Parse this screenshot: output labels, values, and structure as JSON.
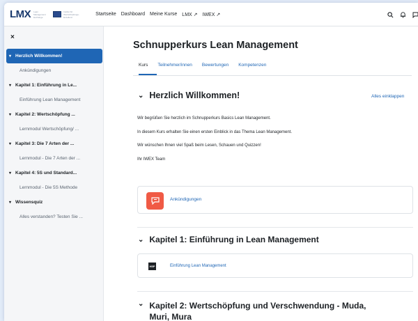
{
  "brand": {
    "logo": "LMX",
    "logo_sub": "Lean Management Exchange",
    "partner_text": "Institut für Wertschöpfungs-Exzellenz"
  },
  "topnav": {
    "items": [
      "Startseite",
      "Dashboard",
      "Meine Kurse",
      "LMX ↗",
      "IWEX ↗"
    ]
  },
  "icons": {
    "search": "search-icon",
    "bell": "bell-icon",
    "chat": "chat-icon",
    "close": "close-icon"
  },
  "sidebar": {
    "close_glyph": "×",
    "items": [
      {
        "label": "Herzlich Willkommen!",
        "type": "section",
        "active": true
      },
      {
        "label": "Ankündigungen",
        "type": "sub"
      },
      {
        "label": "Kapitel 1: Einführung in Le...",
        "type": "section"
      },
      {
        "label": "Einführung Lean Management",
        "type": "sub"
      },
      {
        "label": "Kapitel 2: Wertschöpfung ...",
        "type": "section"
      },
      {
        "label": "Lernmodul Wertschöpfung/ ...",
        "type": "sub"
      },
      {
        "label": "Kapitel 3: Die 7 Arten der ...",
        "type": "section"
      },
      {
        "label": "Lernmodul - Die 7 Arten der ...",
        "type": "sub"
      },
      {
        "label": "Kapitel 4: 5S und Standard...",
        "type": "section"
      },
      {
        "label": "Lernmodul - Die 5S Methode",
        "type": "sub"
      },
      {
        "label": "Wissensquiz",
        "type": "section"
      },
      {
        "label": "Alles verstanden? Testen Sie ...",
        "type": "sub"
      }
    ]
  },
  "main": {
    "course_title": "Schnupperkurs Lean Management",
    "tabs": [
      "Kurs",
      "Teilnehmer/innen",
      "Bewertungen",
      "Kompetenzen"
    ],
    "collapse_all": "Alles einklappen",
    "welcome_title": "Herzlich Willkommen!",
    "welcome_paragraphs": [
      "Wir begrüßen Sie herzlich im Schnupperkurs Basics Lean Management.",
      "In diesem Kurs erhalten Sie einen ersten Einblick in das Thema Lean Management.",
      "Wir wünschen Ihnen viel Spaß beim Lesen, Schauen und Quizzen!",
      "Ihr IWEX Team"
    ],
    "announcements_label": "Ankündigungen",
    "chapter1_title": "Kapitel 1: Einführung in Lean Management",
    "chapter1_activity": "Einführung Lean Management",
    "chapter1_icon_text": "H5P",
    "chapter2_title_line1": "Kapitel 2: Wertschöpfung und Verschwendung - Muda,",
    "chapter2_title_line2": "Muri, Mura"
  },
  "colors": {
    "accent": "#1f66b5",
    "announcement_icon": "#f05a45",
    "sidebar_bg": "#f5f6f8"
  }
}
